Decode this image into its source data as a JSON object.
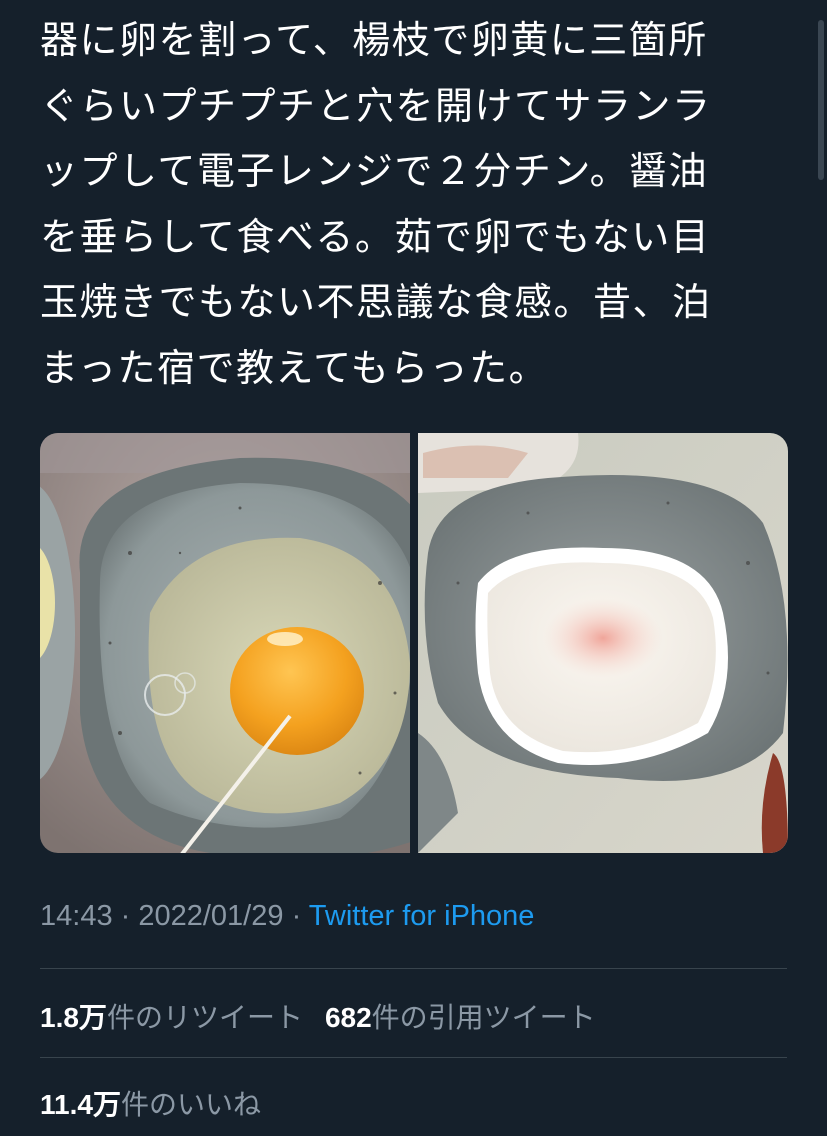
{
  "tweet": {
    "text": "器に卵を割って、楊枝で卵黄に三箇所\nぐらいプチプチと穴を開けてサランラ\nップして電子レンジで２分チン。醤油\nを垂らして食べる。茹で卵でもない目\n玉焼きでもない不思議な食感。昔、泊\nまった宿で教えてもらった。"
  },
  "media": [
    {
      "description": "raw egg in grey ceramic bowl with toothpick",
      "alt": "raw-egg-photo"
    },
    {
      "description": "microwaved egg in grey ceramic bowl",
      "alt": "cooked-egg-photo"
    }
  ],
  "meta": {
    "time": "14:43",
    "separator1": " · ",
    "date": "2022/01/29",
    "separator2": " · ",
    "source": "Twitter for iPhone"
  },
  "stats": {
    "retweets_count": "1.8万",
    "retweets_label": "件のリツイート",
    "quotes_count": "682",
    "quotes_label": "件の引用ツイート",
    "likes_count": "11.4万",
    "likes_label": "件のいいね"
  },
  "colors": {
    "background": "#15202b",
    "text": "#ffffff",
    "secondary": "#8b98a5",
    "link": "#1d9bf0",
    "divider": "#38444d"
  }
}
